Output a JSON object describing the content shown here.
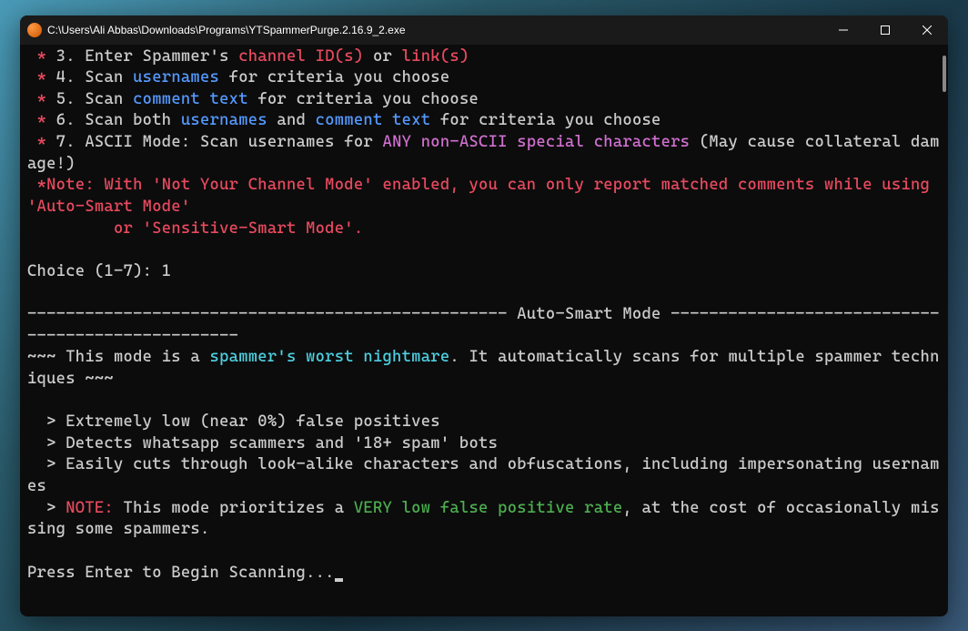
{
  "titlebar": {
    "title": "C:\\Users\\Ali Abbas\\Downloads\\Programs\\YTSpammerPurge.2.16.9_2.exe"
  },
  "content": {
    "star": " * ",
    "opt3_a": "3. Enter Spammer's ",
    "opt3_b": "channel ID(s)",
    "opt3_c": " or ",
    "opt3_d": "link(s)",
    "opt4_a": "4. Scan ",
    "opt4_b": "usernames",
    "opt4_c": " for criteria you choose",
    "opt5_a": "5. Scan ",
    "opt5_b": "comment text",
    "opt5_c": " for criteria you choose",
    "opt6_a": "6. Scan both ",
    "opt6_b": "usernames",
    "opt6_c": " and ",
    "opt6_d": "comment text",
    "opt6_e": " for criteria you choose",
    "opt7_a": "7. ASCII Mode: Scan usernames for ",
    "opt7_b": "ANY non-ASCII special characters",
    "opt7_c": " (May cause collateral damage!)",
    "note1": " *Note: With 'Not Your Channel Mode' enabled, you can only report matched comments while using 'Auto-Smart Mode'",
    "note2": "         or 'Sensitive-Smart Mode'.",
    "choice_label": "Choice (1-7): ",
    "choice_value": "1",
    "divider": "-------------------------------------------------- Auto-Smart Mode --------------------------------------------------",
    "mode_a": "~~~ This mode is a ",
    "mode_b": "spammer's worst nightmare",
    "mode_c": ". It automatically scans for multiple spammer techniques ~~~",
    "b1": "  > Extremely low (near 0%) false positives",
    "b2": "  > Detects whatsapp scammers and '18+ spam' bots",
    "b3": "  > Easily cuts through look-alike characters and obfuscations, including impersonating usernames",
    "b4_a": "  > ",
    "b4_b": "NOTE:",
    "b4_c": " This mode prioritizes a ",
    "b4_d": "VERY low false positive rate",
    "b4_e": ", at the cost of occasionally missing some spammers.",
    "press_enter": "Press Enter to Begin Scanning..."
  }
}
